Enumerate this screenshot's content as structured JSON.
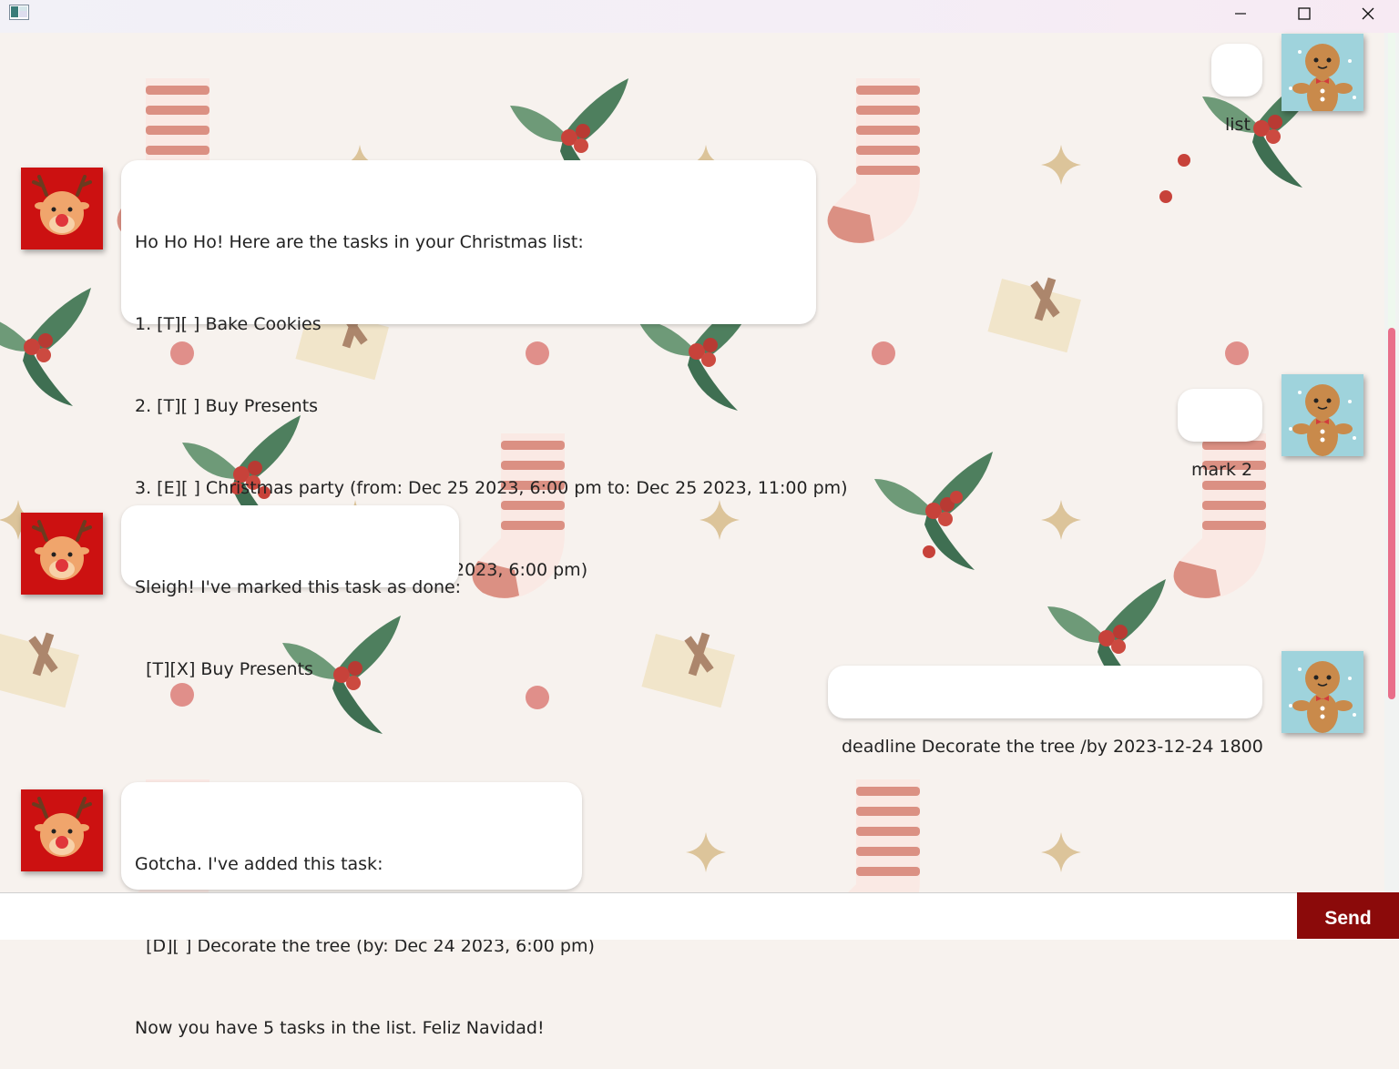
{
  "window": {
    "minimize_icon": "minimize-icon",
    "maximize_icon": "maximize-icon",
    "close_icon": "close-icon"
  },
  "messages": [
    {
      "sender": "user",
      "lines": [
        "list"
      ]
    },
    {
      "sender": "bot",
      "lines": [
        "Ho Ho Ho! Here are the tasks in your Christmas list:",
        "1. [T][ ] Bake Cookies",
        "2. [T][ ] Buy Presents",
        "3. [E][ ] Christmas party (from: Dec 25 2023, 6:00 pm to: Dec 25 2023, 11:00 pm)",
        "4. [D][ ] Finish wrapping (by: Dec 24 2023, 6:00 pm)"
      ]
    },
    {
      "sender": "user",
      "lines": [
        "mark 2"
      ]
    },
    {
      "sender": "bot",
      "lines": [
        "Sleigh! I've marked this task as done:",
        "  [T][X] Buy Presents"
      ]
    },
    {
      "sender": "user",
      "lines": [
        "deadline Decorate the tree /by 2023-12-24 1800"
      ]
    },
    {
      "sender": "bot",
      "lines": [
        "Gotcha. I've added this task:",
        "  [D][ ] Decorate the tree (by: Dec 24 2023, 6:00 pm)",
        "Now you have 5 tasks in the list. Feliz Navidad!"
      ]
    }
  ],
  "avatars": {
    "user": "gingerbread-avatar",
    "bot": "reindeer-avatar"
  },
  "input": {
    "value": "",
    "placeholder": ""
  },
  "send_button": {
    "label": "Send"
  },
  "colors": {
    "send_button": "#8b0a0a",
    "scrollbar_thumb": "#e96f8a",
    "bot_avatar_bg": "#cc1111",
    "user_avatar_bg": "#9fd3dc"
  }
}
